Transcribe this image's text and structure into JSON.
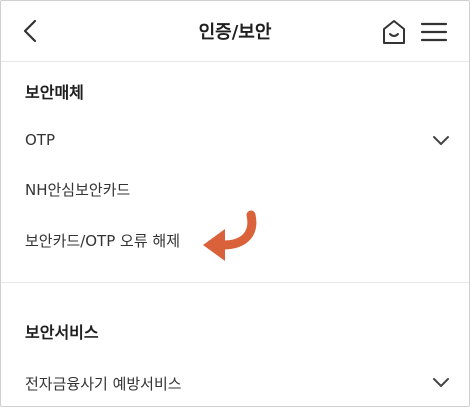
{
  "header": {
    "title": "인증/보안",
    "back_icon": "chevron-left-icon",
    "home_icon": "home-icon",
    "menu_icon": "hamburger-menu-icon"
  },
  "sections": [
    {
      "title": "보안매체",
      "items": [
        {
          "label": "OTP",
          "expandable": true
        },
        {
          "label": "NH안심보안카드",
          "expandable": false
        },
        {
          "label": "보안카드/OTP 오류 해제",
          "expandable": false,
          "highlighted": true
        }
      ]
    },
    {
      "title": "보안서비스",
      "items": [
        {
          "label": "전자금융사기 예방서비스",
          "expandable": true
        }
      ]
    }
  ],
  "colors": {
    "accent_arrow": "#d9623b",
    "text": "#333333",
    "divider": "#e8e8e8"
  }
}
